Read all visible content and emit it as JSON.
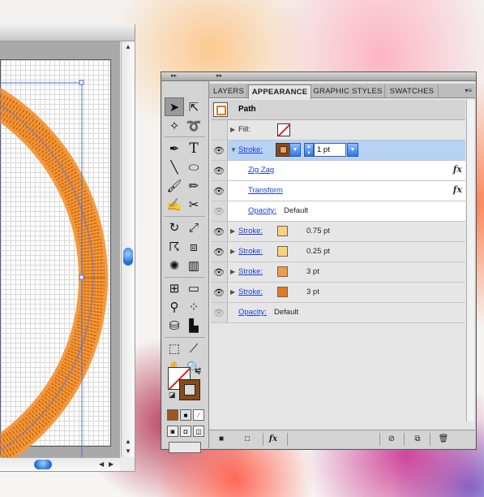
{
  "panel": {
    "tabs": [
      "LAYERS",
      "APPEARANCE",
      "GRAPHIC STYLES",
      "SWATCHES"
    ],
    "active_tab": "APPEARANCE",
    "object_label": "Path",
    "rows": [
      {
        "kind": "fill",
        "label": "Fill:"
      },
      {
        "kind": "stroke",
        "label": "Stroke:",
        "weight": "1 pt"
      },
      {
        "kind": "effect",
        "label": "Zig Zag"
      },
      {
        "kind": "effect",
        "label": "Transform"
      },
      {
        "kind": "opacity",
        "label": "Opacity:",
        "value": "Default"
      },
      {
        "kind": "stroke",
        "label": "Stroke:",
        "weight": "0.75 pt",
        "color": "#ffd27a"
      },
      {
        "kind": "stroke",
        "label": "Stroke:",
        "weight": "0.25 pt",
        "color": "#ffd27a"
      },
      {
        "kind": "stroke",
        "label": "Stroke:",
        "weight": "3 pt",
        "color": "#f59a3e"
      },
      {
        "kind": "stroke",
        "label": "Stroke:",
        "weight": "3 pt",
        "color": "#e8781a"
      },
      {
        "kind": "opacity",
        "label": "Opacity:",
        "value": "Default"
      }
    ],
    "fx_symbol": "fx"
  },
  "colors": {
    "accent_orange": "#e8821e",
    "stroke_swatch": "#8b4a1a",
    "selection_blue": "#b7d2f3"
  },
  "icons": {
    "tools": [
      "selection-tool",
      "direct-selection-tool",
      "magic-wand-tool",
      "lasso-tool",
      "pen-tool",
      "type-tool",
      "line-tool",
      "ellipse-tool",
      "paintbrush-tool",
      "pencil-tool",
      "blob-brush-tool",
      "scissors-tool",
      "rotate-tool",
      "scale-tool",
      "warp-tool",
      "free-transform-tool",
      "symbol-sprayer-tool",
      "column-graph-tool",
      "mesh-tool",
      "gradient-tool",
      "eyedropper-tool",
      "blend-tool",
      "live-paint-bucket-tool",
      "graph-tool",
      "artboard-tool",
      "slice-tool",
      "hand-tool",
      "zoom-tool"
    ]
  }
}
